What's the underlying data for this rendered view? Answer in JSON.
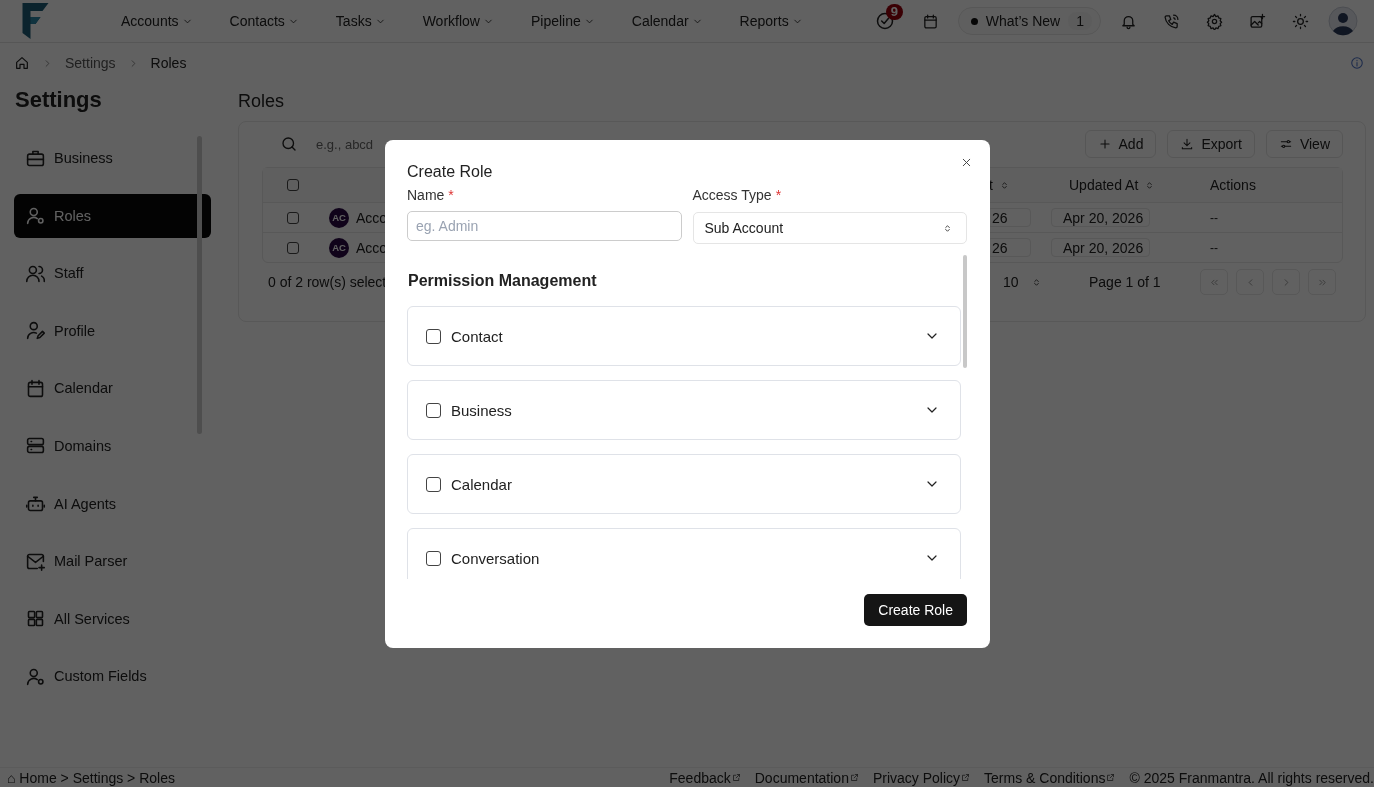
{
  "top_nav": {
    "items": [
      {
        "label": "Accounts"
      },
      {
        "label": "Contacts"
      },
      {
        "label": "Tasks"
      },
      {
        "label": "Workflow"
      },
      {
        "label": "Pipeline"
      },
      {
        "label": "Calendar"
      },
      {
        "label": "Reports"
      }
    ],
    "tasks_badge": "9",
    "whats_new": {
      "label": "What’s New",
      "count": "1"
    }
  },
  "breadcrumb": [
    "Settings",
    "Roles"
  ],
  "sidebar": {
    "title": "Settings",
    "items": [
      {
        "label": "Business",
        "selected": false
      },
      {
        "label": "Roles",
        "selected": true
      },
      {
        "label": "Staff",
        "selected": false
      },
      {
        "label": "Profile",
        "selected": false
      },
      {
        "label": "Calendar",
        "selected": false
      },
      {
        "label": "Domains",
        "selected": false
      },
      {
        "label": "AI Agents",
        "selected": false
      },
      {
        "label": "Mail Parser",
        "selected": false
      },
      {
        "label": "All Services",
        "selected": false
      },
      {
        "label": "Custom Fields",
        "selected": false
      }
    ]
  },
  "page": {
    "title": "Roles",
    "search": {
      "placeholder": "e.g., abcd"
    },
    "toolbar": [
      "Add",
      "Export",
      "View"
    ],
    "table": {
      "select_all_checked": false,
      "columns": [
        {
          "label": "t",
          "sortable": true
        },
        {
          "label": "Updated At",
          "sortable": true
        },
        {
          "label": "Actions",
          "sortable": false
        }
      ],
      "rows": [
        {
          "selected": false,
          "avatar": "AC",
          "name": "Acco",
          "column_3": "26",
          "updated_at": "Apr 20, 2026",
          "actions": "--"
        },
        {
          "selected": false,
          "avatar": "AC",
          "name": "Acco",
          "column_3": "26",
          "updated_at": "Apr 20, 2026",
          "actions": "--"
        }
      ]
    },
    "footer": {
      "selection": "0 of 2 row(s) select",
      "page_size": "10",
      "page": "Page 1 of 1"
    }
  },
  "modal": {
    "title": "Create Role",
    "name_field": {
      "label": "Name",
      "required_mark": "*",
      "placeholder": "eg. Admin"
    },
    "access_type": {
      "label": "Access Type",
      "required_mark": "*",
      "value": "Sub Account"
    },
    "section_title": "Permission Management",
    "permissions": [
      {
        "label": "Contact",
        "checked": false,
        "expanded": false
      },
      {
        "label": "Business",
        "checked": false,
        "expanded": false
      },
      {
        "label": "Calendar",
        "checked": false,
        "expanded": false
      },
      {
        "label": "Conversation",
        "checked": false,
        "expanded": false
      }
    ],
    "submit": "Create Role"
  },
  "status_bar": {
    "breadcrumb": "⌂ Home > Settings > Roles",
    "links": [
      "Feedback",
      "Documentation",
      "Privacy Policy",
      "Terms & Conditions"
    ],
    "copyright": "© 2025 Franmantra. All rights reserved."
  }
}
